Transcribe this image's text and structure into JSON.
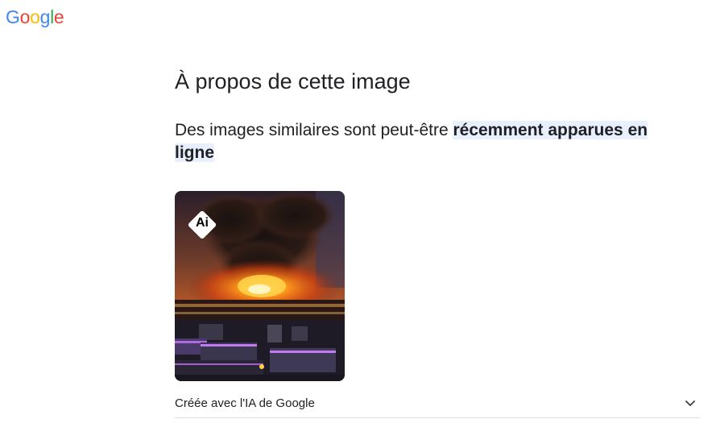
{
  "logo": {
    "letters": [
      "G",
      "o",
      "o",
      "g",
      "l",
      "e"
    ],
    "colors": [
      "#4285F4",
      "#EA4335",
      "#FBBC05",
      "#4285F4",
      "#34A853",
      "#EA4335"
    ]
  },
  "page_title": "À propos de cette image",
  "subtitle": {
    "plain": "Des images similaires sont peut-être ",
    "highlight": "récemment apparues en ligne"
  },
  "image": {
    "badge": "Ai",
    "icon": "ai-badge-icon"
  },
  "caption": {
    "text": "Créée avec l'IA de Google",
    "icon": "chevron-down-icon"
  },
  "colors": {
    "highlight_bg": "#e8f0fe",
    "text": "#202124",
    "divider": "#dadce0"
  }
}
